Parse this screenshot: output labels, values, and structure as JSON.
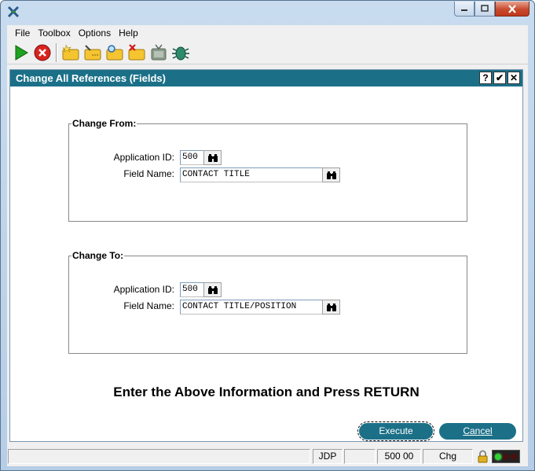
{
  "menu": {
    "items": [
      {
        "label": "File",
        "mnemonic": "F"
      },
      {
        "label": "Toolbox",
        "mnemonic": "T"
      },
      {
        "label": "Options",
        "mnemonic": "O"
      },
      {
        "label": "Help",
        "mnemonic": "H"
      }
    ]
  },
  "toolbar": {
    "icons": [
      "run-icon",
      "stop-icon",
      "new-folder-icon",
      "edit-folder-icon",
      "search-folder-icon",
      "delete-folder-icon",
      "tv-icon",
      "bug-icon"
    ]
  },
  "dialog": {
    "title": "Change All References (Fields)",
    "help_btn": "?",
    "ok_btn": "✔",
    "close_btn": "✕",
    "from": {
      "legend": "Change From:",
      "app_label": "Application ID:",
      "app_value": "500",
      "field_label": "Field Name:",
      "field_value": "CONTACT TITLE"
    },
    "to": {
      "legend": "Change To:",
      "app_label": "Application ID:",
      "app_value": "500",
      "field_label": "Field Name:",
      "field_value": "CONTACT TITLE/POSITION"
    },
    "prompt": "Enter the Above Information and Press RETURN",
    "execute_label": "Execute",
    "cancel_label": "Cancel"
  },
  "status": {
    "user": "JDP",
    "blank": "",
    "code": "500 00",
    "mode": "Chg"
  },
  "colors": {
    "accent": "#1b7088",
    "light_green": "#30d030",
    "light_off": "#4a1010"
  }
}
